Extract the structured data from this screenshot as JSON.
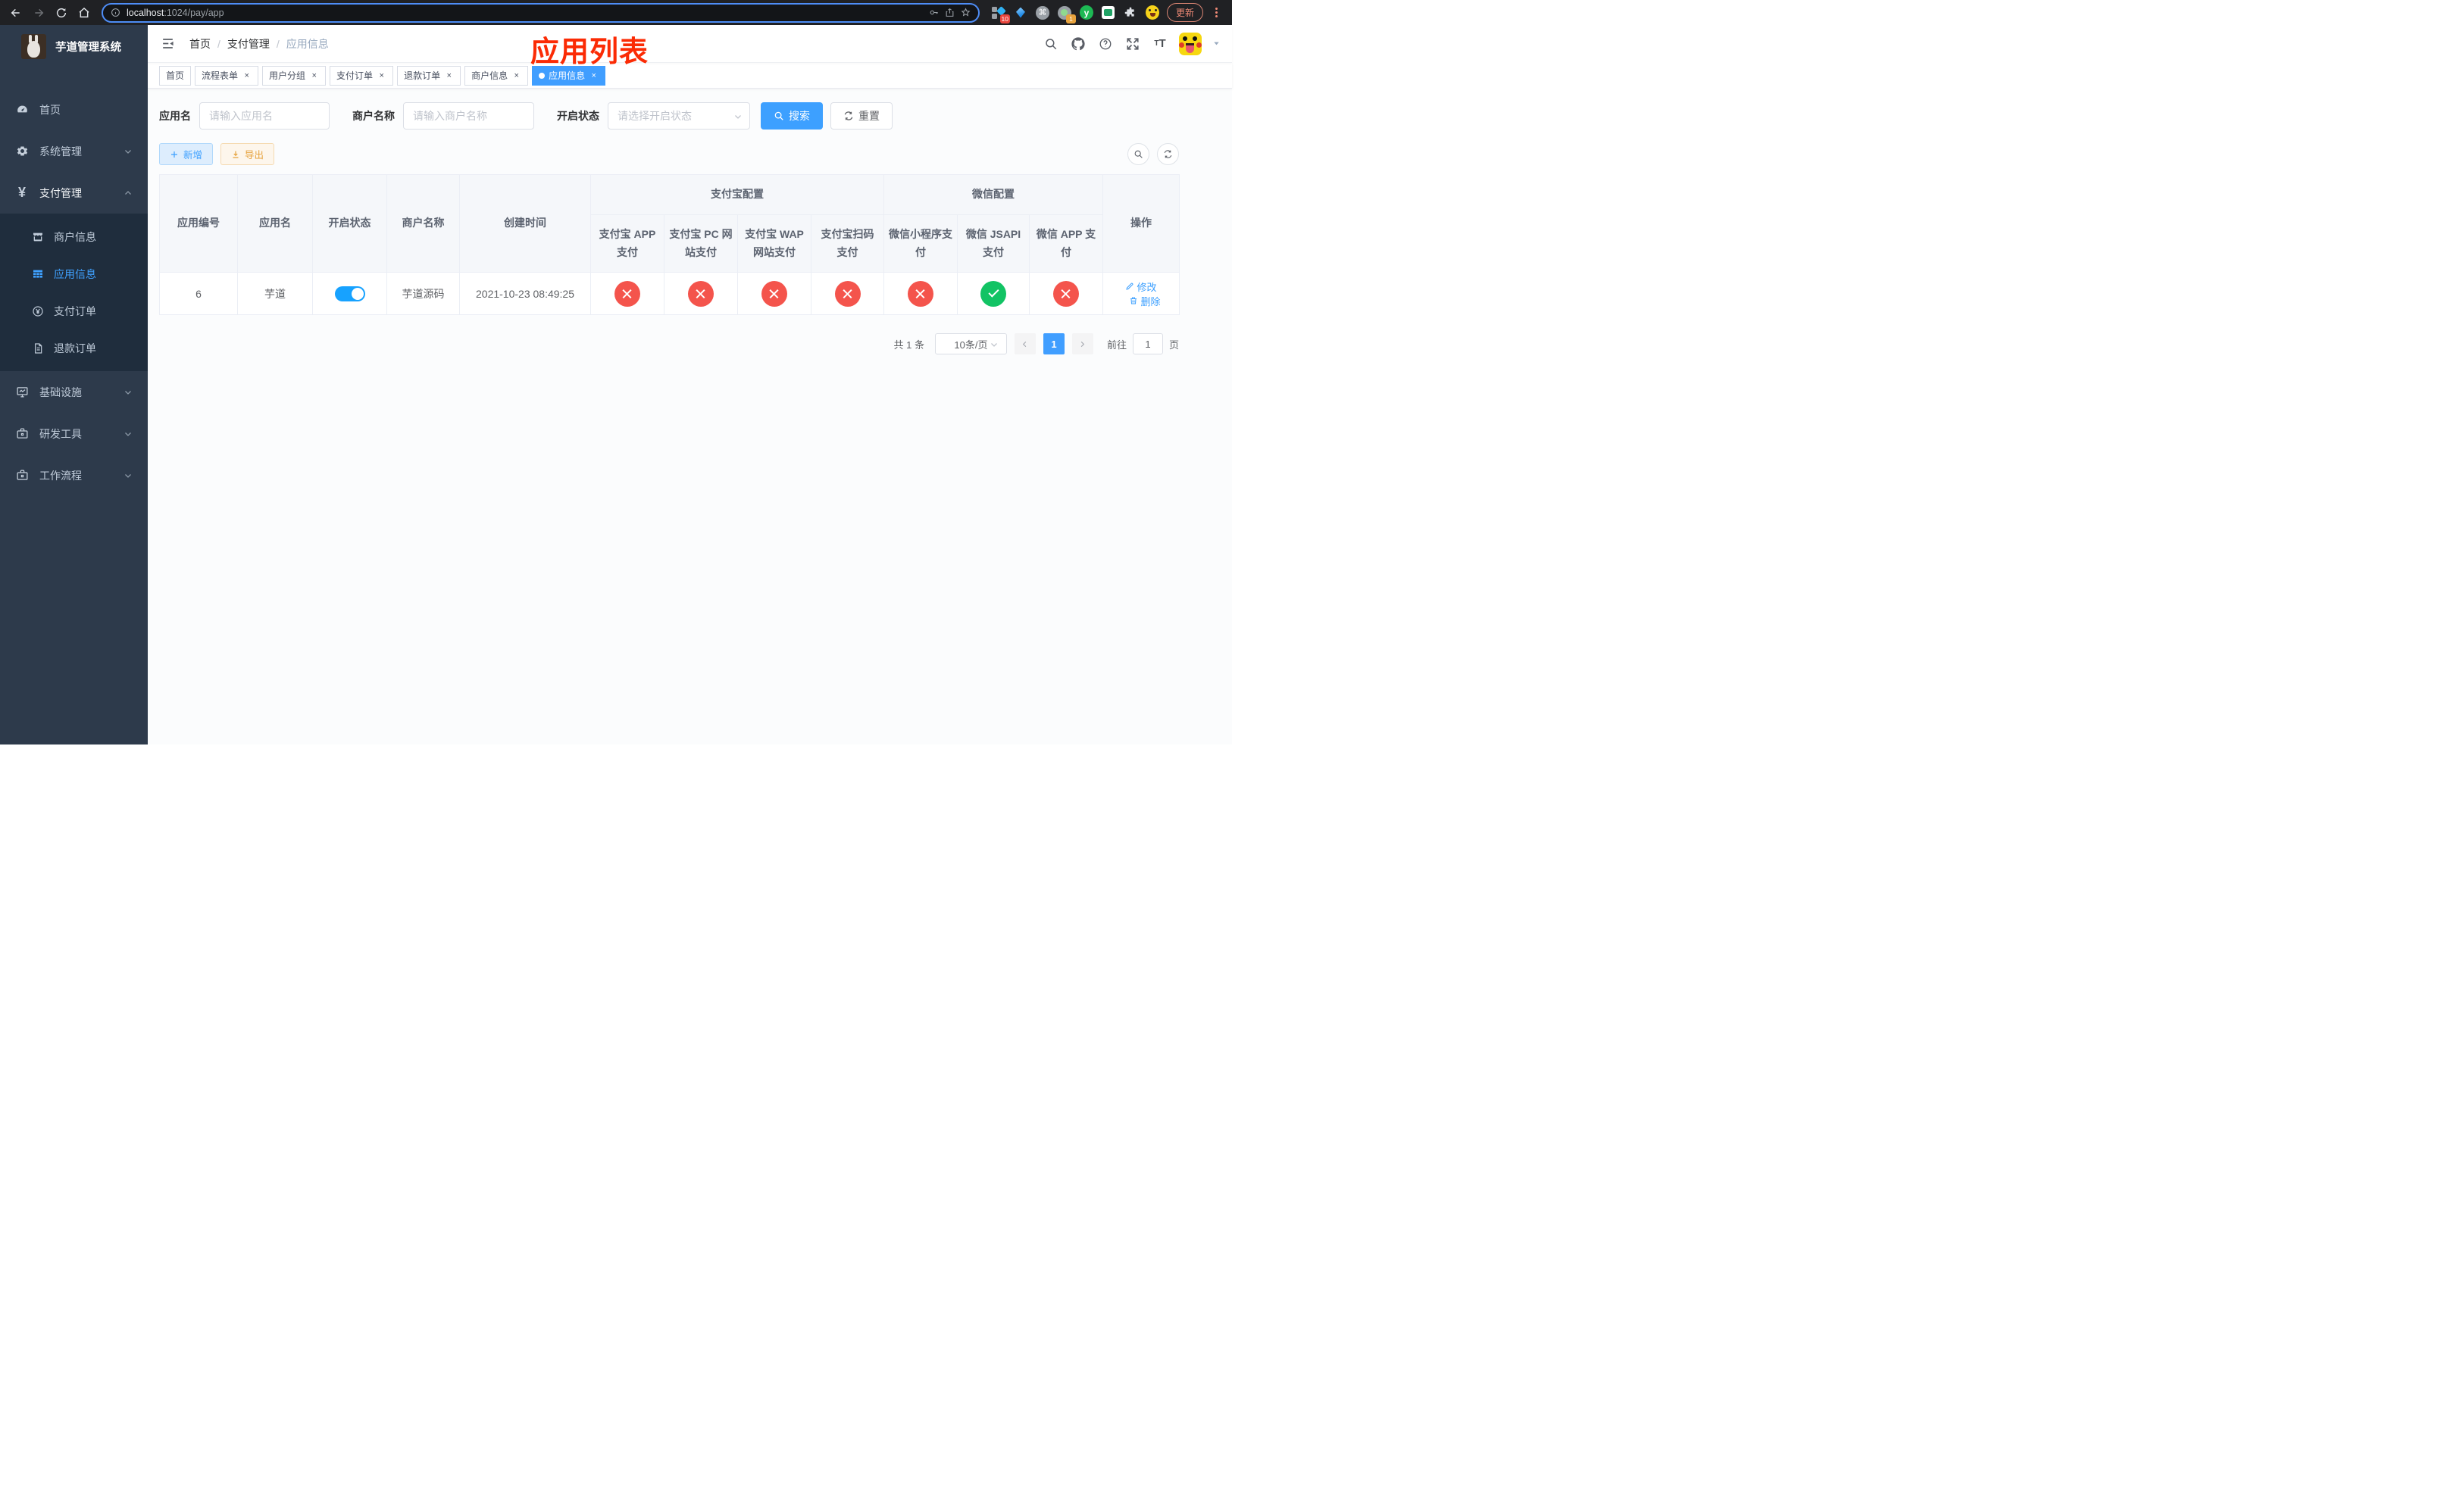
{
  "colors": {
    "primary": "#409eff",
    "switch_on": "#17a2ff",
    "status_closed": "#f4544c",
    "status_open": "#12c364",
    "warning": "#e6a23c",
    "sidebar_bg": "#2d3a4b",
    "submenu_bg": "#1f2d3d",
    "annotation_red": "#fb2b05",
    "chrome_bg": "#202124",
    "urlbar_ring": "#4e8df6"
  },
  "browser": {
    "url_host": "localhost",
    "url_path": ":1024/pay/app",
    "update_label": "更新",
    "pin_badge": "10",
    "proxy_badge": "1",
    "y_ext_label": "y"
  },
  "sidebar": {
    "title": "芋道管理系统",
    "items": [
      {
        "label": "首页"
      },
      {
        "label": "系统管理"
      },
      {
        "label": "支付管理"
      },
      {
        "label": "基础设施"
      },
      {
        "label": "研发工具"
      },
      {
        "label": "工作流程"
      }
    ],
    "payment_subitems": [
      {
        "label": "商户信息"
      },
      {
        "label": "应用信息"
      },
      {
        "label": "支付订单"
      },
      {
        "label": "退款订单"
      }
    ]
  },
  "navbar": {
    "breadcrumb": [
      "首页",
      "支付管理",
      "应用信息"
    ],
    "annotation": "应用列表"
  },
  "tabs": [
    {
      "label": "首页"
    },
    {
      "label": "流程表单"
    },
    {
      "label": "用户分组"
    },
    {
      "label": "支付订单"
    },
    {
      "label": "退款订单"
    },
    {
      "label": "商户信息"
    },
    {
      "label": "应用信息"
    }
  ],
  "filters": {
    "app_name_label": "应用名",
    "app_name_placeholder": "请输入应用名",
    "merchant_label": "商户名称",
    "merchant_placeholder": "请输入商户名称",
    "status_label": "开启状态",
    "status_placeholder": "请选择开启状态",
    "search_label": "搜索",
    "reset_label": "重置"
  },
  "toolbar": {
    "add_label": "新增",
    "export_label": "导出"
  },
  "table": {
    "simple_columns": [
      "应用编号",
      "应用名",
      "开启状态",
      "商户名称",
      "创建时间"
    ],
    "alipay_group": "支付宝配置",
    "alipay_columns": [
      "支付宝 APP 支付",
      "支付宝 PC 网站支付",
      "支付宝 WAP 网站支付",
      "支付宝扫码支付"
    ],
    "wechat_group": "微信配置",
    "wechat_columns": [
      "微信小程序支付",
      "微信 JSAPI 支付",
      "微信 APP 支付"
    ],
    "action_column": "操作",
    "row": {
      "id": "6",
      "name": "芋道",
      "enabled": true,
      "merchant": "芋道源码",
      "created_at": "2021-10-23 08:49:25",
      "pay_statuses": [
        "closed",
        "closed",
        "closed",
        "closed",
        "closed",
        "open",
        "closed"
      ],
      "edit_label": "修改",
      "delete_label": "删除"
    }
  },
  "pagination": {
    "total": "共 1 条",
    "page_size": "10条/页",
    "current_page": "1",
    "goto_label": "前往",
    "goto_value": "1",
    "page_unit": "页"
  }
}
